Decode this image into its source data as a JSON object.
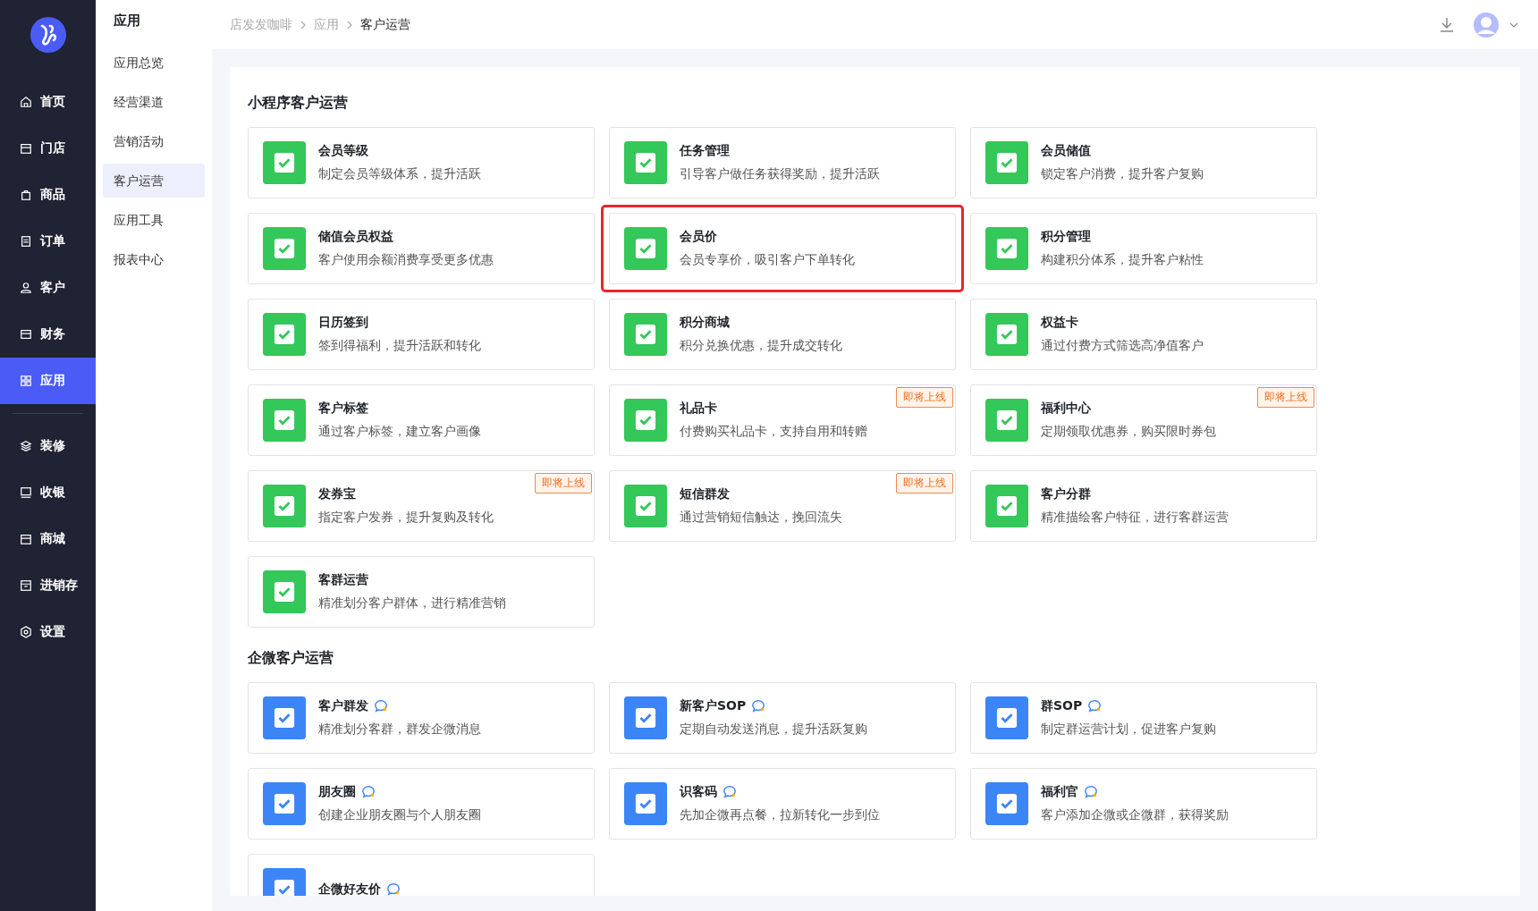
{
  "nav": [
    [
      {
        "label": "首页",
        "selected": false
      },
      {
        "label": "门店",
        "selected": false
      },
      {
        "label": "商品",
        "selected": false
      },
      {
        "label": "订单",
        "selected": false
      },
      {
        "label": "客户",
        "selected": false
      },
      {
        "label": "财务",
        "selected": false
      },
      {
        "label": "应用",
        "selected": true
      }
    ],
    [
      {
        "label": "装修",
        "selected": false
      },
      {
        "label": "收银",
        "selected": false
      },
      {
        "label": "商城",
        "selected": false
      },
      {
        "label": "进销存",
        "selected": false
      },
      {
        "label": "设置",
        "selected": false
      }
    ]
  ],
  "subnav": {
    "title": "应用",
    "items": [
      {
        "label": "应用总览",
        "selected": false
      },
      {
        "label": "经营渠道",
        "selected": false
      },
      {
        "label": "营销活动",
        "selected": false
      },
      {
        "label": "客户运营",
        "selected": true
      },
      {
        "label": "应用工具",
        "selected": false
      },
      {
        "label": "报表中心",
        "selected": false
      }
    ]
  },
  "breadcrumb": [
    "店发发咖啡",
    "应用",
    "客户运营"
  ],
  "sections": [
    {
      "title": "小程序客户运营",
      "color": "#34c759",
      "cards": [
        {
          "title": "会员等级",
          "desc": "制定会员等级体系，提升活跃"
        },
        {
          "title": "任务管理",
          "desc": "引导客户做任务获得奖励，提升活跃"
        },
        {
          "title": "会员储值",
          "desc": "锁定客户消费，提升客户复购"
        },
        {
          "title": "储值会员权益",
          "desc": "客户使用余额消费享受更多优惠"
        },
        {
          "title": "会员价",
          "desc": "会员专享价，吸引客户下单转化",
          "highlighted": true
        },
        {
          "title": "积分管理",
          "desc": "构建积分体系，提升客户粘性"
        },
        {
          "title": "日历签到",
          "desc": "签到得福利，提升活跃和转化"
        },
        {
          "title": "积分商城",
          "desc": "积分兑换优惠，提升成交转化"
        },
        {
          "title": "权益卡",
          "desc": "通过付费方式筛选高净值客户"
        },
        {
          "title": "客户标签",
          "desc": "通过客户标签，建立客户画像"
        },
        {
          "title": "礼品卡",
          "desc": "付费购买礼品卡，支持自用和转赠",
          "badge": "即将上线"
        },
        {
          "title": "福利中心",
          "desc": "定期领取优惠券，购买限时券包",
          "badge": "即将上线"
        },
        {
          "title": "发券宝",
          "desc": "指定客户发券，提升复购及转化",
          "badge": "即将上线"
        },
        {
          "title": "短信群发",
          "desc": "通过营销短信触达，挽回流失",
          "badge": "即将上线"
        },
        {
          "title": "客户分群",
          "desc": "精准描绘客户特征，进行客群运营"
        },
        {
          "title": "客群运营",
          "desc": "精准划分客户群体，进行精准营销"
        }
      ]
    },
    {
      "title": "企微客户运营",
      "color": "#3c85f7",
      "cards": [
        {
          "title": "客户群发",
          "desc": "精准划分客群，群发企微消息",
          "wecom": true
        },
        {
          "title": "新客户SOP",
          "desc": "定期自动发送消息，提升活跃复购",
          "wecom": true
        },
        {
          "title": "群SOP",
          "desc": "制定群运营计划，促进客户复购",
          "wecom": true
        },
        {
          "title": "朋友圈",
          "desc": "创建企业朋友圈与个人朋友圈",
          "wecom": true
        },
        {
          "title": "识客码",
          "desc": "先加企微再点餐，拉新转化一步到位",
          "wecom": true
        },
        {
          "title": "福利官",
          "desc": "客户添加企微或企微群，获得奖励",
          "wecom": true
        },
        {
          "title": "企微好友价",
          "wecom": true
        }
      ]
    }
  ]
}
